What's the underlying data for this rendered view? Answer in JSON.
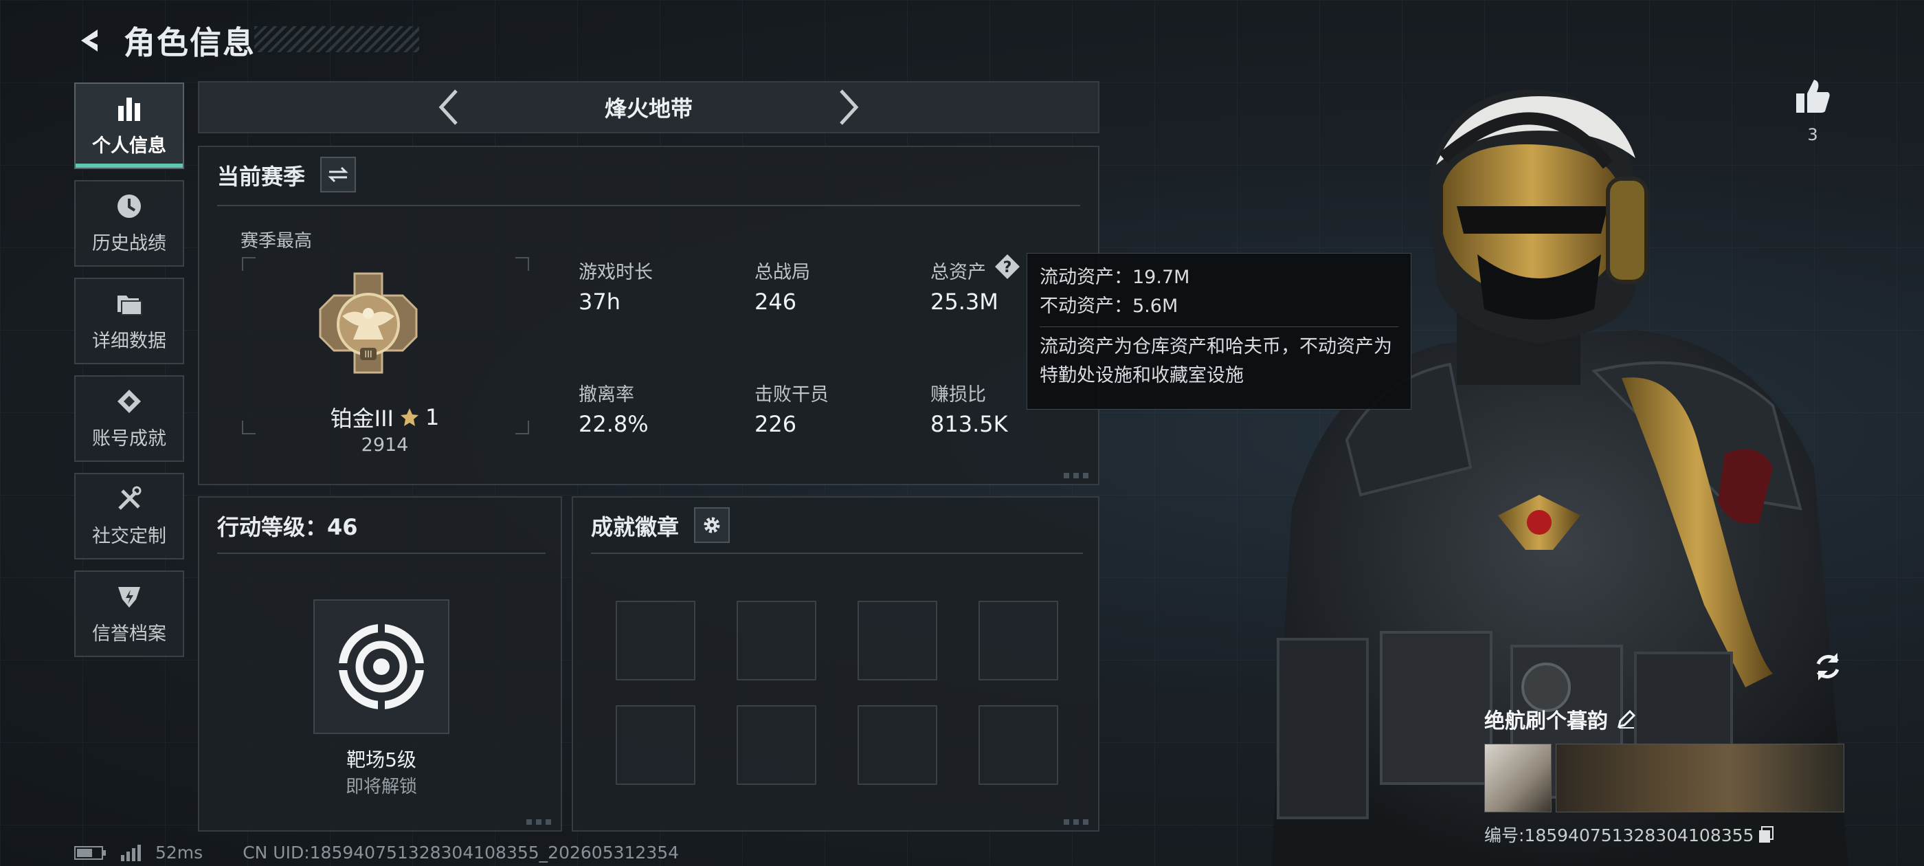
{
  "header": {
    "title": "角色信息"
  },
  "sidebar": {
    "items": [
      {
        "label": "个人信息",
        "icon": "bar-chart-icon"
      },
      {
        "label": "历史战绩",
        "icon": "clock-icon"
      },
      {
        "label": "详细数据",
        "icon": "folder-icon"
      },
      {
        "label": "账号成就",
        "icon": "achievement-icon"
      },
      {
        "label": "社交定制",
        "icon": "tools-icon"
      },
      {
        "label": "信誉档案",
        "icon": "shield-icon"
      }
    ]
  },
  "mode": {
    "name": "烽火地带"
  },
  "season": {
    "title": "当前赛季",
    "best_label": "赛季最高",
    "rank_name": "铂金III",
    "rank_stars": "1",
    "rank_score": "2914",
    "stats": [
      {
        "label": "游戏时长",
        "value": "37h"
      },
      {
        "label": "总战局",
        "value": "246"
      },
      {
        "label": "总资产",
        "value": "25.3M"
      },
      {
        "label": "撤离率",
        "value": "22.8%"
      },
      {
        "label": "击败干员",
        "value": "226"
      },
      {
        "label": "赚损比",
        "value": "813.5K"
      }
    ]
  },
  "tooltip": {
    "line1": "流动资产：19.7M",
    "line2": "不动资产：5.6M",
    "desc": "流动资产为仓库资产和哈夫币，不动资产为特勤处设施和收藏室设施"
  },
  "level": {
    "title": "行动等级：46",
    "item_name": "靶场5级",
    "item_status": "即将解锁"
  },
  "badges": {
    "title": "成就徽章"
  },
  "footer": {
    "ping": "52ms",
    "uid": "CN UID:185940751328304108355_202605312354"
  },
  "player": {
    "likes": "3",
    "name": "绝航刷个暮韵",
    "id": "编号:185940751328304108355"
  },
  "colors": {
    "accent": "#5fc8b0",
    "panel": "#1c2126",
    "text": "#d8dcdf"
  }
}
